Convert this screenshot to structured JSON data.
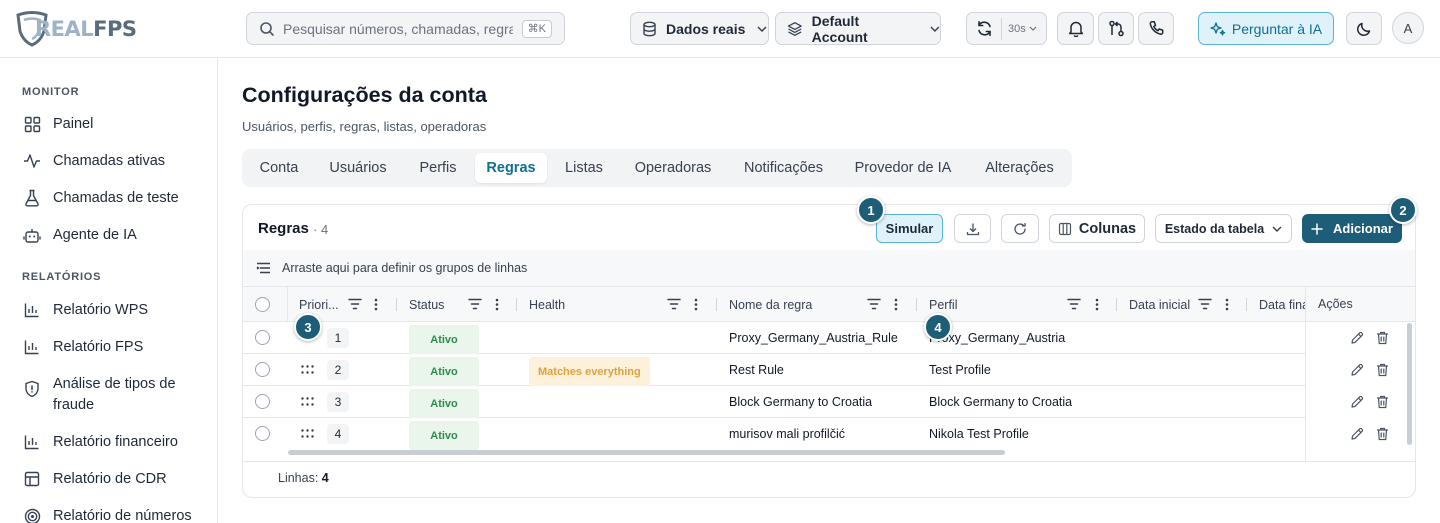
{
  "brand": {
    "logo_text_r": "REAL",
    "logo_text_f": "FPS"
  },
  "search": {
    "placeholder": "Pesquisar números, chamadas, regras...",
    "shortcut": "⌘K"
  },
  "topbar": {
    "data_source": "Dados reais",
    "account": "Default Account",
    "refresh_interval": "30s",
    "ai_button": "Perguntar à IA",
    "avatar": "A"
  },
  "sidebar": {
    "monitor_heading": "MONITOR",
    "monitor_items": [
      {
        "label": "Painel",
        "icon": "dashboard-icon"
      },
      {
        "label": "Chamadas ativas",
        "icon": "activity-icon"
      },
      {
        "label": "Chamadas de teste",
        "icon": "flask-icon"
      },
      {
        "label": "Agente de IA",
        "icon": "bot-icon"
      }
    ],
    "reports_heading": "RELATÓRIOS",
    "report_items": [
      {
        "label": "Relatório WPS",
        "icon": "bar-chart-icon"
      },
      {
        "label": "Relatório FPS",
        "icon": "bar-chart-icon"
      },
      {
        "label": "Análise de tipos de fraude",
        "icon": "shield-icon"
      },
      {
        "label": "Relatório financeiro",
        "icon": "bar-chart-icon"
      },
      {
        "label": "Relatório de CDR",
        "icon": "table-icon"
      },
      {
        "label": "Relatório de números",
        "icon": "target-icon"
      }
    ]
  },
  "page": {
    "title": "Configurações da conta",
    "subtitle": "Usuários, perfis, regras, listas, operadoras",
    "tabs": [
      "Conta",
      "Usuários",
      "Perfis",
      "Regras",
      "Listas",
      "Operadoras",
      "Notificações",
      "Provedor de IA",
      "Alterações"
    ],
    "active_tab": "Regras"
  },
  "rules_card": {
    "title": "Regras",
    "count": "· 4",
    "simulate": "Simular",
    "columns": "Colunas",
    "table_state": "Estado da tabela",
    "add": "Adicionar",
    "group_hint": "Arraste aqui para definir os grupos de linhas",
    "headers": {
      "priority": "Priori...",
      "status": "Status",
      "health": "Health",
      "name": "Nome da regra",
      "profile": "Perfil",
      "start_date": "Data inicial",
      "end_date": "Data fina",
      "actions": "Ações"
    },
    "rows": [
      {
        "priority": "1",
        "status": "Ativo",
        "health": "",
        "name": "Proxy_Germany_Austria_Rule",
        "profile": "Proxy_Germany_Austria"
      },
      {
        "priority": "2",
        "status": "Ativo",
        "health": "Matches everything",
        "name": "Rest Rule",
        "profile": "Test Profile"
      },
      {
        "priority": "3",
        "status": "Ativo",
        "health": "",
        "name": "Block Germany to Croatia",
        "profile": "Block Germany to Croatia"
      },
      {
        "priority": "4",
        "status": "Ativo",
        "health": "",
        "name": "murisov mali profilčić",
        "profile": "Nikola Test Profile"
      }
    ],
    "footer_label": "Linhas:",
    "footer_count": "4"
  },
  "callouts": [
    "1",
    "2",
    "3",
    "4"
  ],
  "colors": {
    "accent": "#1d5d77",
    "accent_light": "#dff2fa",
    "active_green": "#2e8b4b",
    "warning": "#e0a13c"
  }
}
